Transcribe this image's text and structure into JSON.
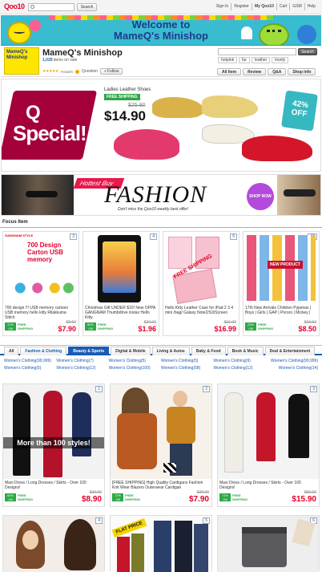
{
  "topbar": {
    "logo": "Qoo10",
    "search_button": "Search",
    "nav": [
      "Sign In",
      "Register",
      "My Qoo10",
      "Cart",
      "GSM",
      "Help"
    ]
  },
  "banner": {
    "line1": "Welcome to",
    "line2": "MameQ's Minishop"
  },
  "shop": {
    "logo_text": "MameQ's Minishop",
    "name": "MameQ's Minishop",
    "items_count": "1,029",
    "items_suffix": "items on sale",
    "stars": "★★★★★",
    "power_label": "POWER",
    "question_label": "Question",
    "follow_label": "Follow",
    "search_button": "Search",
    "tags": [
      "hotpink",
      "fur",
      "leather",
      "lovely"
    ],
    "tabs": [
      "All Item",
      "Review",
      "Q&A",
      "Shop Info"
    ]
  },
  "qspecial": {
    "q": "Q",
    "special": "Special!",
    "product": "Ladies Leather Shoes",
    "free_shipping": "FREE SHIPPING",
    "old_price": "$25.90",
    "new_price": "$14.90",
    "discount": "42%",
    "off": "OFF"
  },
  "fashion": {
    "hottest": "Hottest Buy",
    "title": "FASHION",
    "tagline": "Don't miss the Qoo10 weekly best offer!",
    "shop_now": "SHOP NOW"
  },
  "focus": {
    "label": "Focus Item",
    "items": [
      {
        "num": "3",
        "title": "700 design !!! USB memory cartoon USB memory hello kitty Rilakkuma Stitch",
        "discount": "17%",
        "badge_off": "Off",
        "free": "FREE SHIPPING",
        "old": "$8.50",
        "price": "$7.90",
        "img_text1": "GANGNAM STYLE",
        "img_text2": "700 Design Carton USB memory"
      },
      {
        "num": "4",
        "title": "Christmas Gift UNDER $10! New OPPA GANGNAM Thumbdrive instax Hello Kitty",
        "discount": "80%",
        "badge_off": "Off",
        "free": "FREE SHIPPING",
        "old": "$29.00",
        "price": "$1.96"
      },
      {
        "num": "5",
        "title": "Hello Kitty Leather Case for iPad 2 3 4 mini /bag/ Galaxy Note2/S3/Screen",
        "discount": "",
        "badge_off": "",
        "free": "",
        "old": "$16.99",
        "price": "$16.99",
        "img_text1": "FREE SHIPPING"
      },
      {
        "num": "12",
        "title": "17th New Arrivals Children Pyjamas | Boys | Girls | GAP | Pororo | Mickey |",
        "discount": "22%",
        "badge_off": "Off",
        "free": "FREE SHIPPING",
        "old": "$15.50",
        "price": "$8.50",
        "img_text1": "NEW PRODUCT"
      }
    ]
  },
  "categories": {
    "tabs": [
      "All",
      "Fashion & Clothing",
      "Beauty & Sports",
      "Digital & Mobile",
      "Living & Autos",
      "Baby & Food",
      "Book & Music",
      "Deal & Entertainment"
    ],
    "links": [
      "Women's Clothing(99,999)",
      "Women's Clothing(7)",
      "Women's Clothing(5)",
      "Women's Clothing(5)",
      "Women's Clothing(9)",
      "Women's Clothing(99,999)",
      "Women's Clothing(5)",
      "Women's Clothing(12)",
      "Women's Clothing(100)",
      "Women's Clothing(58)",
      "Women's Clothing(12)",
      "Women's Clothing(14)"
    ]
  },
  "grid": {
    "items": [
      {
        "num": "1",
        "title": "Maxi Dress / Long Dresses / Skirts - Over 100 Designs!",
        "discount": "60%",
        "badge_off": "Off",
        "free": "FREE SHIPPING",
        "old": "$20.00",
        "price": "$8.90",
        "img_text": "More than 100 styles!"
      },
      {
        "num": "2",
        "title": "[FREE SHIPPING] High Quality Cardigans Fashion Knit Wear Blazers Outerwear Cardigan",
        "discount": "72%",
        "badge_off": "Off",
        "free": "FREE SHIPPING",
        "old": "$28.00",
        "price": "$7.90"
      },
      {
        "num": "3",
        "title": "Maxi Dress / Long Dresses / Skirts - Over 100 Designs!",
        "discount": "71%",
        "badge_off": "Off",
        "free": "FREE SHIPPING",
        "old": "$55.00",
        "price": "$15.90"
      }
    ],
    "bottom": [
      {
        "num": "4",
        "img_text": ""
      },
      {
        "num": "5",
        "img_text": "FLAT PRICE"
      },
      {
        "num": "6",
        "img_text": ""
      }
    ]
  }
}
